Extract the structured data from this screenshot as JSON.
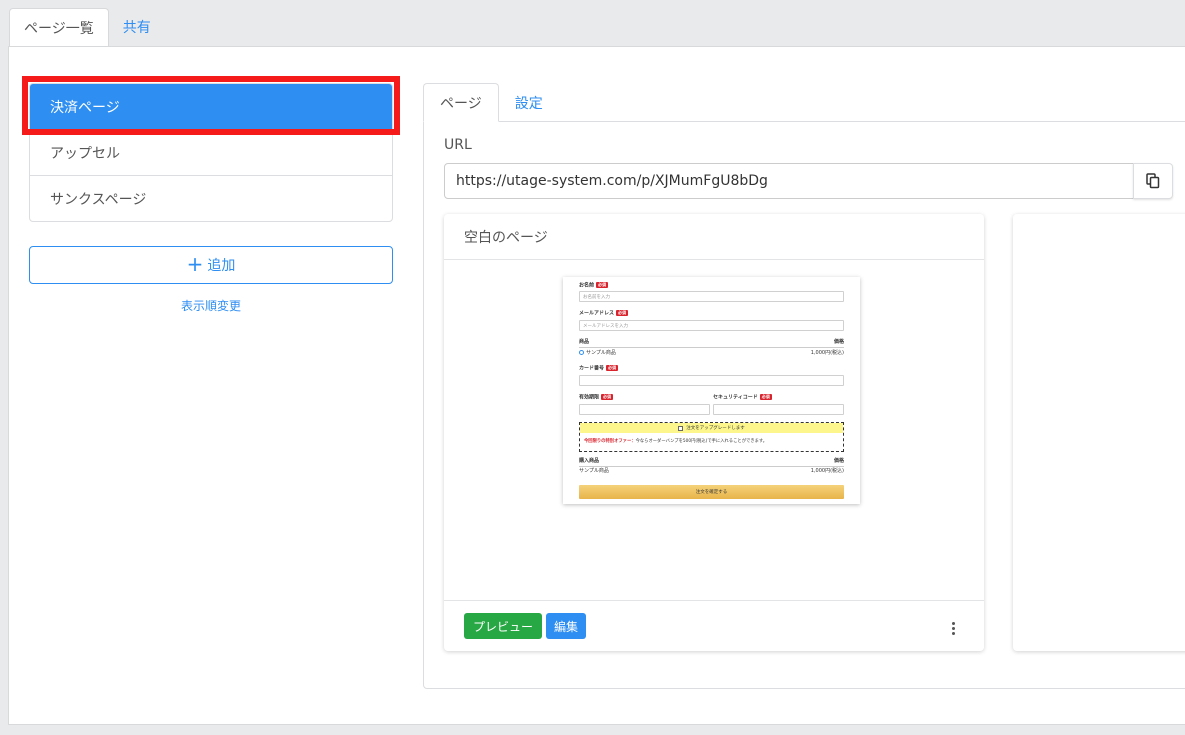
{
  "top_tabs": {
    "pages": "ページ一覧",
    "share": "共有"
  },
  "sidebar": {
    "items": [
      "決済ページ",
      "アップセル",
      "サンクスページ"
    ],
    "add_label": "追加",
    "reorder_label": "表示順変更"
  },
  "detail_tabs": {
    "page": "ページ",
    "settings": "設定"
  },
  "url": {
    "label": "URL",
    "value": "https://utage-system.com/p/XJMumFgU8bDg"
  },
  "card": {
    "title": "空白のページ",
    "preview_label": "プレビュー",
    "edit_label": "編集"
  },
  "thumbnail": {
    "name_label": "お名前",
    "required": "必須",
    "name_placeholder": "お名前を入力",
    "email_label": "メールアドレス",
    "email_placeholder": "メールアドレスを入力",
    "product_header": "商品",
    "price_header": "価格",
    "product_name": "サンプル商品",
    "product_price": "1,000円(税込)",
    "card_number_label": "カード番号",
    "expiry_label": "有効期限",
    "security_label": "セキュリティコード",
    "upgrade_label": "注文をアップグレードします",
    "offer_highlight": "今回限りの特別オファー：",
    "offer_text": "今ならオーダーバンプを500円(税込)で手に入れることができます。",
    "purchase_header": "購入商品",
    "purchase_price_header": "価格",
    "purchase_name": "サンプル商品",
    "purchase_price": "1,000円(税込)",
    "confirm_label": "注文を確定する"
  }
}
